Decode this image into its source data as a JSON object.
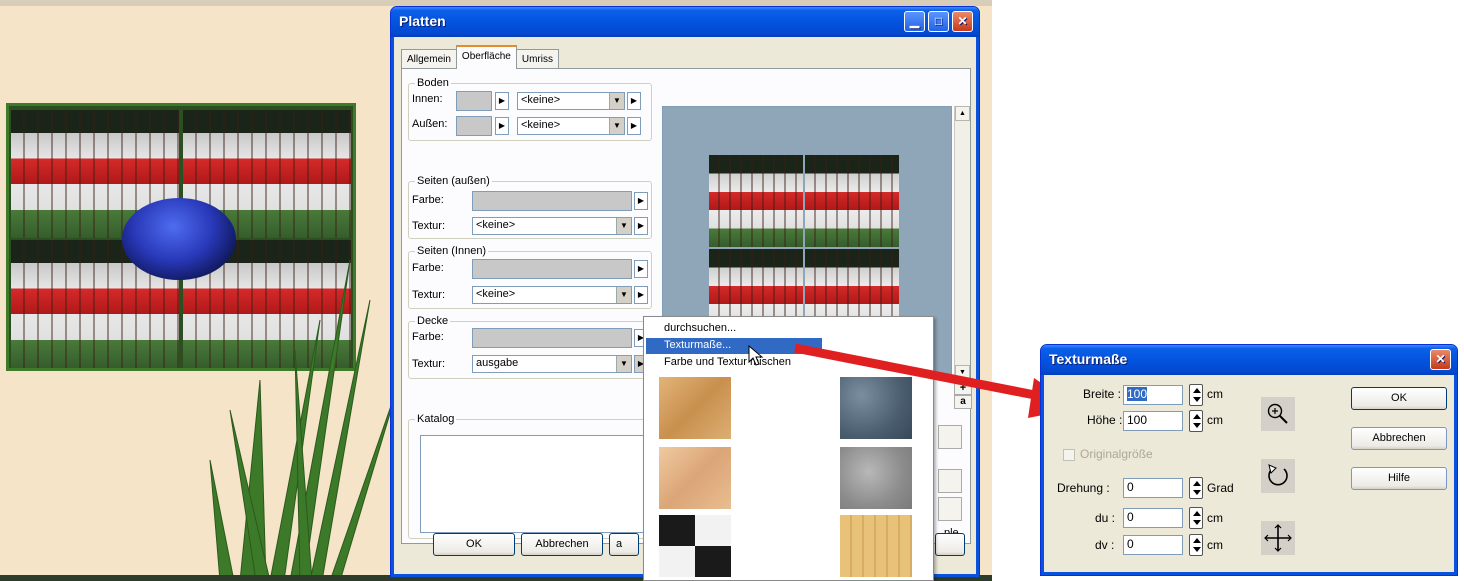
{
  "platten": {
    "title": "Platten",
    "tabs": [
      "Allgemein",
      "Oberfläche",
      "Umriss"
    ],
    "boden": {
      "legend": "Boden",
      "innen_label": "Innen:",
      "aussen_label": "Außen:",
      "innen_texture": "<keine>",
      "aussen_texture": "<keine>"
    },
    "seiten_aussen": {
      "legend": "Seiten (außen)",
      "farbe_label": "Farbe:",
      "textur_label": "Textur:",
      "textur_value": "<keine>"
    },
    "seiten_innen": {
      "legend": "Seiten (Innen)",
      "farbe_label": "Farbe:",
      "textur_label": "Textur:",
      "textur_value": "<keine>"
    },
    "decke": {
      "legend": "Decke",
      "farbe_label": "Farbe:",
      "textur_label": "Textur:",
      "textur_value": "ausgabe"
    },
    "katalog_legend": "Katalog",
    "side_text_ple": "ple",
    "side_text_a": "a",
    "side_text_plus": "+",
    "buttons": {
      "ok": "OK",
      "cancel": "Abbrechen",
      "partial": "a"
    }
  },
  "menu": {
    "items": [
      "durchsuchen...",
      "Texturmaße...",
      "Farbe und Textur mischen"
    ],
    "highlighted_index": 1
  },
  "texturmasse": {
    "title": "Texturmaße",
    "breite_label": "Breite :",
    "breite_value": "100",
    "hoehe_label": "Höhe :",
    "hoehe_value": "100",
    "unit_cm": "cm",
    "originalgroesse_label": "Originalgröße",
    "drehung_label": "Drehung :",
    "drehung_value": "0",
    "unit_grad": "Grad",
    "du_label": "du :",
    "du_value": "0",
    "dv_label": "dv :",
    "dv_value": "0",
    "ok": "OK",
    "cancel": "Abbrechen",
    "help": "Hilfe"
  },
  "icons": [
    "zoom-in-icon",
    "rotate-icon",
    "move-icon",
    "close-icon",
    "minimize-icon",
    "maximize-icon",
    "dropdown-arrow-icon",
    "play-arrow-icon"
  ],
  "colors": {
    "xp_blue": "#0454e0",
    "highlight": "#316ac5",
    "arrow_red": "#e02020",
    "dialog_bg": "#ece9d8"
  }
}
